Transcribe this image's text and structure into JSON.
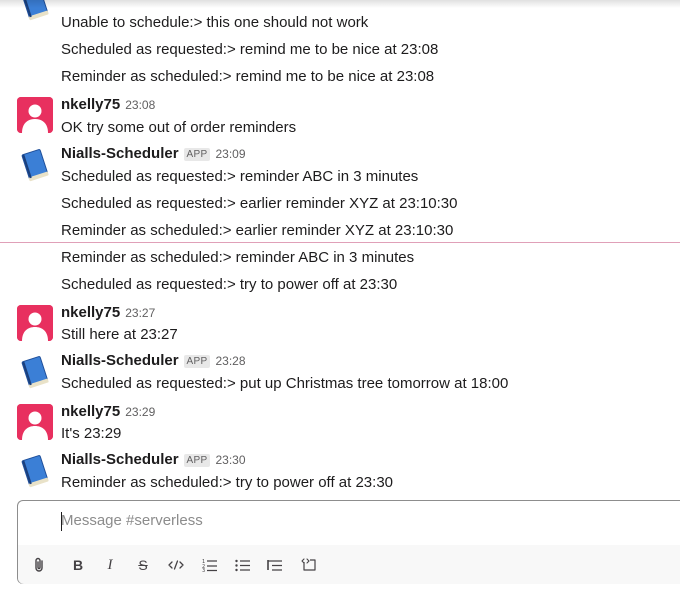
{
  "messages": [
    {
      "type": "continuation",
      "text": "Unable to schedule:> this one should not work"
    },
    {
      "type": "continuation",
      "text": "Scheduled as requested:> remind me to be nice at 23:08"
    },
    {
      "type": "continuation",
      "text": "Reminder as scheduled:> remind me to be nice at 23:08"
    },
    {
      "type": "header",
      "sender": "nkelly75",
      "time": "23:08",
      "text": "OK try some out of order reminders"
    },
    {
      "type": "header",
      "sender": "Nialls-Scheduler",
      "badge": "APP",
      "time": "23:09",
      "text": "Scheduled as requested:> reminder ABC in 3 minutes"
    },
    {
      "type": "continuation",
      "text": "Scheduled as requested:> earlier reminder XYZ at 23:10:30"
    },
    {
      "type": "continuation",
      "text": "Reminder as scheduled:> earlier reminder XYZ at 23:10:30"
    },
    {
      "type": "continuation",
      "text": "Reminder as scheduled:> reminder ABC in 3 minutes"
    },
    {
      "type": "continuation",
      "text": "Scheduled as requested:> try to power off at 23:30"
    },
    {
      "type": "header",
      "sender": "nkelly75",
      "time": "23:27",
      "text": "Still here at 23:27"
    },
    {
      "type": "header",
      "sender": "Nialls-Scheduler",
      "badge": "APP",
      "time": "23:28",
      "text": "Scheduled as requested:> put up Christmas tree tomorrow at 18:00"
    },
    {
      "type": "header",
      "sender": "nkelly75",
      "time": "23:29",
      "text": "It's 23:29"
    },
    {
      "type": "header",
      "sender": "Nialls-Scheduler",
      "badge": "APP",
      "time": "23:30",
      "text": "Reminder as scheduled:> try to power off at 23:30"
    }
  ],
  "composer": {
    "placeholder": "Message #serverless"
  },
  "toolbar": {
    "buttons": [
      "attach-icon",
      "bold-icon",
      "italic-icon",
      "strikethrough-icon",
      "code-icon",
      "numbered-list-icon",
      "bulleted-list-icon",
      "blockquote-icon",
      "code-block-icon"
    ],
    "bold_label": "B",
    "italic_label": "I",
    "strike_label": "S"
  },
  "colors": {
    "user_avatar": "#e8305f",
    "bot_book": "#2f6fc6",
    "new_divider": "#e0a0b8"
  }
}
